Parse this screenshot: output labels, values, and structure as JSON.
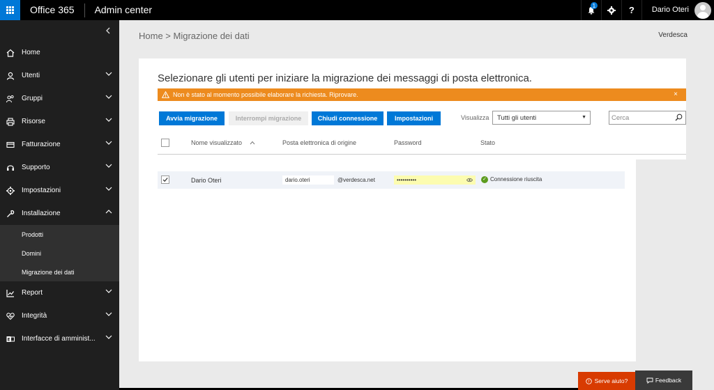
{
  "topbar": {
    "brand": "Office 365",
    "app_title": "Admin center",
    "notification_count": "1",
    "user_name": "Dario Oteri",
    "help_label": "?"
  },
  "sidebar": {
    "collapse_glyph": "‹",
    "items": [
      {
        "label": "Home",
        "icon": "home-icon"
      },
      {
        "label": "Utenti",
        "icon": "user-icon"
      },
      {
        "label": "Gruppi",
        "icon": "group-icon"
      },
      {
        "label": "Risorse",
        "icon": "printer-icon"
      },
      {
        "label": "Fatturazione",
        "icon": "card-icon"
      },
      {
        "label": "Supporto",
        "icon": "headset-icon"
      },
      {
        "label": "Impostazioni",
        "icon": "gear-icon"
      },
      {
        "label": "Installazione",
        "icon": "wrench-icon"
      },
      {
        "label": "Report",
        "icon": "chart-icon"
      },
      {
        "label": "Integrità",
        "icon": "heart-icon"
      },
      {
        "label": "Interfacce di amminist...",
        "icon": "exchange-icon"
      }
    ],
    "sub_items": [
      {
        "label": "Prodotti"
      },
      {
        "label": "Domini"
      },
      {
        "label": "Migrazione dei dati"
      }
    ]
  },
  "main": {
    "breadcrumb": "Home > Migrazione dei dati",
    "tenant": "Verdesca",
    "title": "Selezionare gli utenti per iniziare la migrazione dei messaggi di posta elettronica.",
    "alert": "Non è stato al momento possibile elaborare la richiesta. Riprovare.",
    "alert_close": "×",
    "buttons": {
      "start": "Avvia migrazione",
      "stop": "Interrompi migrazione",
      "close": "Chiudi connessione",
      "settings": "Impostazioni"
    },
    "view_label": "Visualizza",
    "view_selected": "Tutti gli utenti",
    "search_placeholder": "Cerca",
    "columns": {
      "name": "Nome visualizzato",
      "email": "Posta elettronica di origine",
      "password": "Password",
      "status": "Stato"
    },
    "rows": [
      {
        "name": "Dario Oteri",
        "email_user": "dario.oteri",
        "email_domain": "@verdesca.net",
        "password": "••••••••••",
        "status": "Connessione riuscita"
      }
    ]
  },
  "footer": {
    "help": "Serve aiuto?",
    "feedback": "Feedback"
  },
  "colors": {
    "accent": "#0078d7",
    "alert": "#ed8b1e",
    "help": "#d83b01",
    "success": "#5c9b1e"
  }
}
